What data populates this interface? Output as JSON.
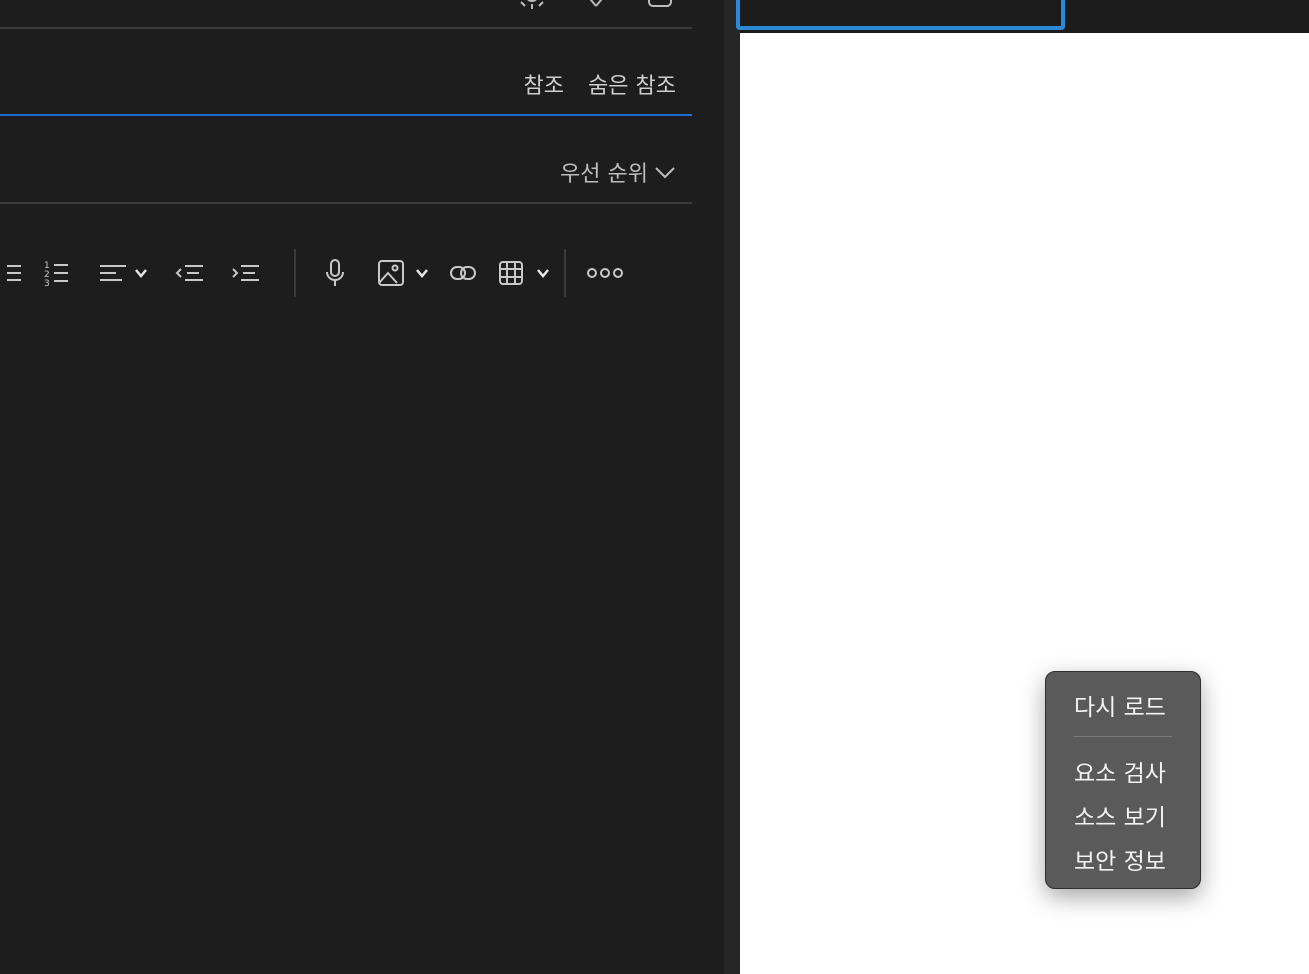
{
  "compose": {
    "cc_label": "참조",
    "bcc_label": "숨은 참조",
    "priority_label": "우선 순위"
  },
  "toolbar": {
    "icons": [
      "bullet-list-icon",
      "numbered-list-icon",
      "align-icon",
      "decrease-indent-icon",
      "increase-indent-icon",
      "microphone-icon",
      "image-icon",
      "link-icon",
      "table-icon",
      "more-icon"
    ]
  },
  "context_menu": {
    "items": [
      "다시 로드",
      "요소 검사",
      "소스 보기",
      "보안 정보"
    ]
  },
  "colors": {
    "editor_bg": "#1d1d1d",
    "accent_blue": "#1e6fd1",
    "focus_ring": "#2b8ad8",
    "menu_bg": "#5a5a5a"
  }
}
